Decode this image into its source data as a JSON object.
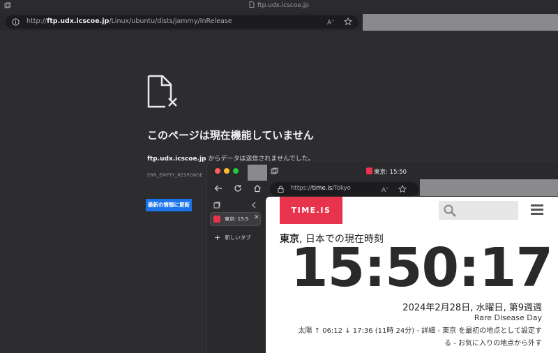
{
  "back_window": {
    "title": "ftp.udx.icscoe.jp",
    "url_prefix": "http://",
    "url_host": "ftp.udx.icscoe.jp",
    "url_path": "/Linux/ubuntu/dists/jammy/InRelease",
    "error_title": "このページは現在機能していません",
    "error_host": "ftp.udx.icscoe.jp",
    "error_message": " からデータは送信されませんでした。",
    "error_code": "ERR_EMPTY_RESPONSE",
    "reload_label": "最新の情報に更新"
  },
  "front_window": {
    "tab_title": "東京: 15:50",
    "url_prefix": "https://",
    "url_host": "time.is",
    "url_path": "/Tokyo",
    "sidebar": {
      "tab_label": "東京: 15:5",
      "new_tab_label": "新しいタブ"
    },
    "page": {
      "logo": "TIME.IS",
      "location_city": "東京",
      "location_rest": ", 日本での現在時刻",
      "clock": "15:50:17",
      "date": "2024年2月28日,  水曜日,  第9週週",
      "event": "Rare Disease Day",
      "sun_line_1": "太陽 ↑ 06:12 ↓ 17:36 (11時 24分) - 詳細 - 東京 を最初の地点として設定す",
      "sun_line_2": "る - お気に入りの地点から外す"
    }
  },
  "colors": {
    "accent_red": "#e7334c",
    "reload_blue": "#1a73e8"
  }
}
